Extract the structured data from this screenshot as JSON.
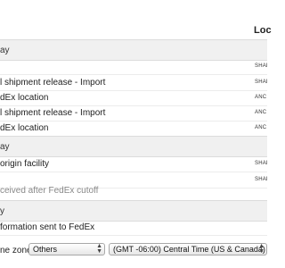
{
  "header": {
    "location_col": "Loc"
  },
  "groups": [
    {
      "label": "ay"
    },
    {
      "label": "ay"
    },
    {
      "label": "y"
    }
  ],
  "rows": [
    {
      "desc": "l shipment release - Import",
      "loc": "SHAI"
    },
    {
      "desc": "dEx location",
      "loc": "ANC"
    },
    {
      "desc": "l shipment release - Import",
      "loc": "ANC"
    },
    {
      "desc": "dEx location",
      "loc": "ANC"
    },
    {
      "desc": "origin facility",
      "loc": "SHAI"
    },
    {
      "desc": "formation sent to FedEx",
      "loc": ""
    }
  ],
  "extra_locs": {
    "first_block": "SHAI",
    "third_block": "SHAI"
  },
  "notes": {
    "after_cutoff": "ceived after FedEx cutoff"
  },
  "timezone": {
    "label": "ne zone",
    "zone_select": "Others",
    "tz_select": "(GMT -06:00)  Central Time (US & Canada)"
  }
}
